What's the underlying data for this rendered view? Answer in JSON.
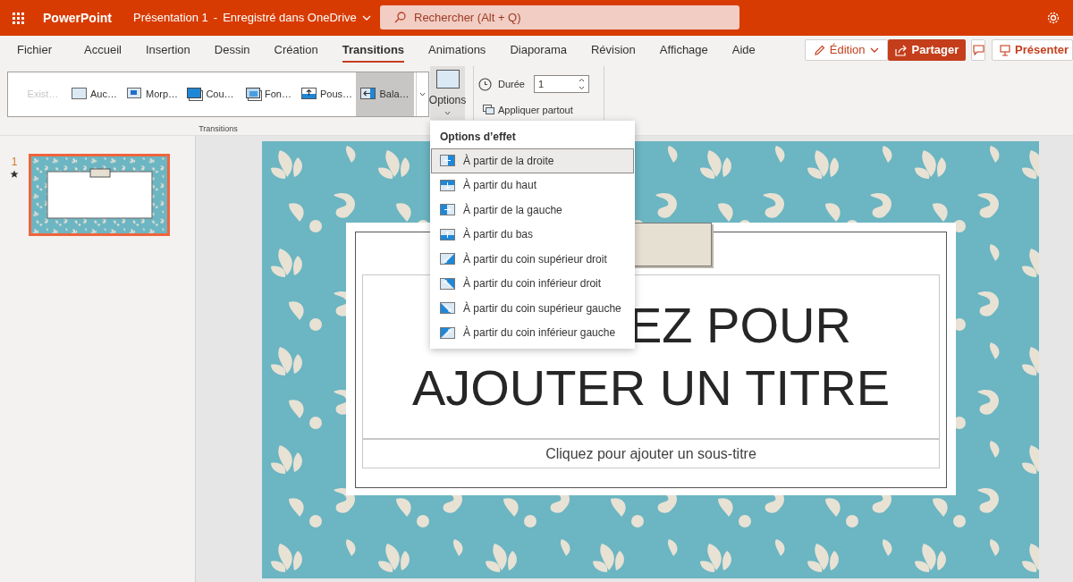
{
  "app": {
    "name": "PowerPoint",
    "document": "Présentation 1",
    "separator": "-",
    "save_status": "Enregistré dans OneDrive"
  },
  "search": {
    "placeholder": "Rechercher (Alt + Q)"
  },
  "tabs": [
    {
      "label": "Fichier",
      "selected": false
    },
    {
      "label": "Accueil",
      "selected": false
    },
    {
      "label": "Insertion",
      "selected": false
    },
    {
      "label": "Dessin",
      "selected": false
    },
    {
      "label": "Création",
      "selected": false
    },
    {
      "label": "Transitions",
      "selected": true
    },
    {
      "label": "Animations",
      "selected": false
    },
    {
      "label": "Diaporama",
      "selected": false
    },
    {
      "label": "Révision",
      "selected": false
    },
    {
      "label": "Affichage",
      "selected": false
    },
    {
      "label": "Aide",
      "selected": false
    }
  ],
  "mode_button": "Édition",
  "actions": {
    "share": "Partager",
    "present": "Présenter"
  },
  "gallery": {
    "group_label": "Transitions",
    "items": [
      {
        "label": "Exist…",
        "kind": "none",
        "selected": false,
        "disabled": true
      },
      {
        "label": "Auc…",
        "kind": "blank",
        "selected": false,
        "disabled": false
      },
      {
        "label": "Morp…",
        "kind": "morph",
        "selected": false,
        "disabled": false
      },
      {
        "label": "Cou…",
        "kind": "cover",
        "selected": false,
        "disabled": false
      },
      {
        "label": "Fon…",
        "kind": "fade",
        "selected": false,
        "disabled": false
      },
      {
        "label": "Pous…",
        "kind": "push",
        "selected": false,
        "disabled": false
      },
      {
        "label": "Bala…",
        "kind": "wipe",
        "selected": true,
        "disabled": false
      }
    ]
  },
  "options_button": {
    "label": "Options",
    "expanded": true
  },
  "duration": {
    "label": "Durée",
    "value": "1"
  },
  "apply_all": "Appliquer partout",
  "thumbnails": [
    {
      "number": "1",
      "selected": true
    }
  ],
  "slide": {
    "title_lines": [
      "EZ POUR",
      "AJOUTER UN TITRE"
    ],
    "subtitle": "Cliquez pour ajouter un sous-titre"
  },
  "menu": {
    "title": "Options d’effet",
    "items": [
      {
        "label": "À partir de la droite",
        "kind": "right",
        "selected": true
      },
      {
        "label": "À partir du haut",
        "kind": "top",
        "selected": false
      },
      {
        "label": "À partir de la gauche",
        "kind": "left",
        "selected": false
      },
      {
        "label": "À partir du bas",
        "kind": "bottom",
        "selected": false
      },
      {
        "label": "À partir du coin supérieur droit",
        "kind": "top-right",
        "selected": false
      },
      {
        "label": "À partir du coin inférieur droit",
        "kind": "bottom-right",
        "selected": false
      },
      {
        "label": "À partir du coin supérieur gauche",
        "kind": "top-left",
        "selected": false
      },
      {
        "label": "À partir du coin inférieur gauche",
        "kind": "bottom-left",
        "selected": false
      }
    ]
  }
}
